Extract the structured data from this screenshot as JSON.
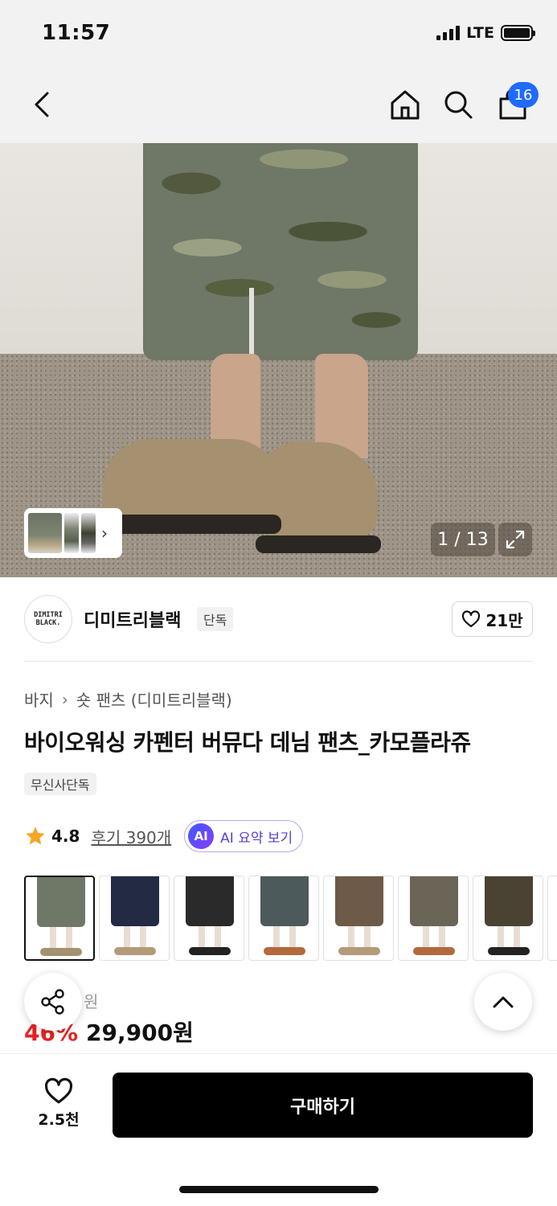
{
  "status_bar": {
    "time": "11:57",
    "network": "LTE",
    "battery_level": 1.0
  },
  "header": {
    "back_icon": "chevron-left-icon",
    "home_icon": "home-icon",
    "search_icon": "search-icon",
    "cart_icon": "shopping-bag-icon",
    "cart_badge": "16",
    "badge_color": "#1f6bff"
  },
  "gallery": {
    "counter": "1 / 13",
    "expand_icon": "expand-icon",
    "current_image": 1,
    "total_images": 13
  },
  "brand": {
    "logo_line1": "DIMITRI",
    "logo_line2": "BLACK.",
    "name": "디미트리블랙",
    "tag": "단독",
    "likes": "21만"
  },
  "product": {
    "breadcrumb": [
      "바지",
      "숏 팬츠 (디미트리블랙)"
    ],
    "title": "바이오워싱 카펜터 버뮤다 데님 팬츠_카모플라쥬",
    "tag": "무신사단독",
    "rating": "4.8",
    "review_link": "후기 390개",
    "ai_badge": "AI",
    "ai_button": "AI 요약 보기",
    "color_options": 8,
    "selected_option": 1,
    "original_price": "원",
    "discount": "46%",
    "price": "29,900원",
    "discount_color": "#e52222"
  },
  "floating": {
    "share_icon": "share-icon",
    "top_icon": "chevron-up-icon"
  },
  "bottom_bar": {
    "wish_count": "2.5천",
    "buy_label": "구매하기"
  }
}
